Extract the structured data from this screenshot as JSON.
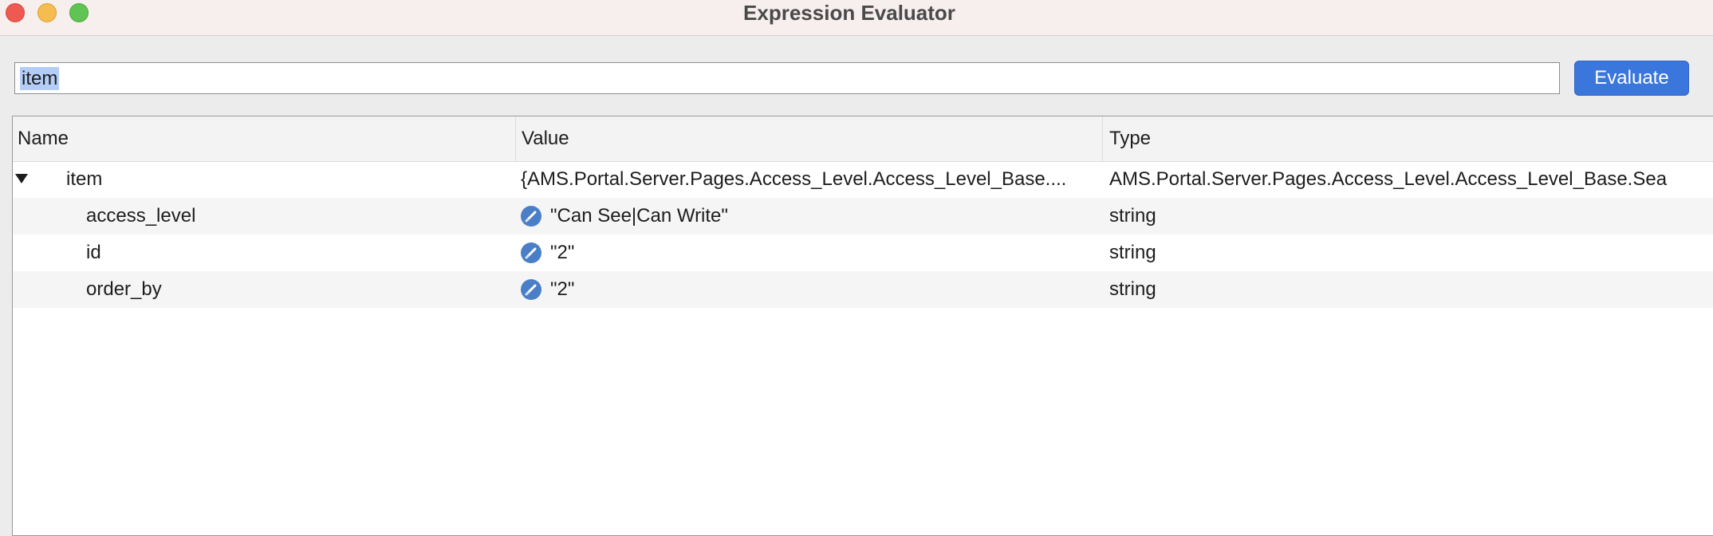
{
  "window": {
    "title": "Expression Evaluator"
  },
  "expression": {
    "value": "item",
    "button_label": "Evaluate"
  },
  "table": {
    "headers": {
      "name": "Name",
      "value": "Value",
      "type": "Type"
    },
    "rows": [
      {
        "name": "item",
        "value": "{AMS.Portal.Server.Pages.Access_Level.Access_Level_Base....",
        "type": "AMS.Portal.Server.Pages.Access_Level.Access_Level_Base.Sea"
      },
      {
        "name": "access_level",
        "value": "\"Can See|Can Write\"",
        "type": "string"
      },
      {
        "name": "id",
        "value": "\"2\"",
        "type": "string"
      },
      {
        "name": "order_by",
        "value": "\"2\"",
        "type": "string"
      }
    ]
  },
  "colors": {
    "accent": "#3b76dc",
    "selection": "#b3cdf7",
    "edit_icon": "#4a7fc8"
  },
  "icons": {
    "expand": "chevron-down-icon",
    "edit": "pencil-icon"
  }
}
